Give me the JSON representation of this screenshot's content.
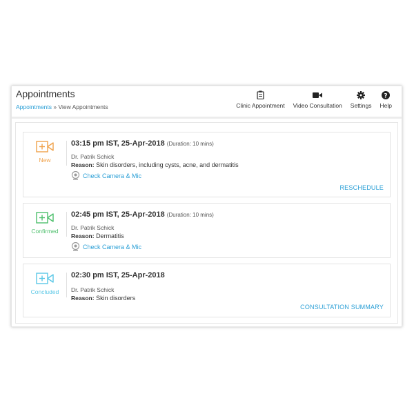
{
  "header": {
    "title": "Appointments",
    "breadcrumb_link": "Appointments",
    "breadcrumb_sep": "»",
    "breadcrumb_current": "View Appointments"
  },
  "toolbar": [
    {
      "label": "Clinic Appointment",
      "icon": "clipboard-icon"
    },
    {
      "label": "Video Consultation",
      "icon": "video-camera-icon"
    },
    {
      "label": "Settings",
      "icon": "gear-icon"
    },
    {
      "label": "Help",
      "icon": "help-icon"
    }
  ],
  "appointments": [
    {
      "status": "New",
      "status_color": "#f0a24b",
      "time": "03:15 pm IST, 25-Apr-2018",
      "duration": "(Duration: 10 mins)",
      "doctor": "Dr. Patrik Schick",
      "reason_label": "Reason:",
      "reason": "Skin disorders, including cysts, acne, and dermatitis",
      "check_label": "Check Camera & Mic",
      "action": "RESCHEDULE"
    },
    {
      "status": "Confirmed",
      "status_color": "#4cbf6b",
      "time": "02:45 pm IST, 25-Apr-2018",
      "duration": "(Duration: 10 mins)",
      "doctor": "Dr. Patrik Schick",
      "reason_label": "Reason:",
      "reason": "Dermatitis",
      "check_label": "Check Camera & Mic",
      "action": ""
    },
    {
      "status": "Concluded",
      "status_color": "#5bc8e6",
      "time": "02:30 pm IST, 25-Apr-2018",
      "duration": "",
      "doctor": "Dr. Patrik Schick",
      "reason_label": "Reason:",
      "reason": "Skin disorders",
      "check_label": "",
      "action": "CONSULTATION SUMMARY"
    }
  ],
  "colors": {
    "link": "#2a9fd6"
  }
}
